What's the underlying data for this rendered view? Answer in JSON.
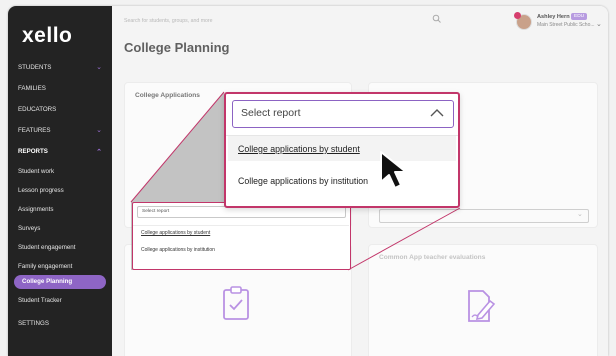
{
  "app": {
    "logo": "xello"
  },
  "sidebar": {
    "items": [
      {
        "label": "STUDENTS",
        "chevron": "chevron-down"
      },
      {
        "label": "FAMILIES"
      },
      {
        "label": "EDUCATORS"
      },
      {
        "label": "FEATURES",
        "chevron": "chevron-down"
      },
      {
        "label": "REPORTS",
        "chevron": "chevron-up"
      },
      {
        "label": "Student work"
      },
      {
        "label": "Lesson progress"
      },
      {
        "label": "Assignments"
      },
      {
        "label": "Surveys"
      },
      {
        "label": "Student engagement"
      },
      {
        "label": "Family engagement"
      },
      {
        "label": "College Planning",
        "active": true
      },
      {
        "label": "Student Tracker"
      },
      {
        "label": "SETTINGS"
      }
    ]
  },
  "header": {
    "search_placeholder": "Search for students, groups, and more",
    "user_name": "Ashley Hern",
    "user_role": "EDU",
    "user_school": "Main Street Public Scho..."
  },
  "page": {
    "title": "College Planning",
    "cards": [
      {
        "title": "College Applications",
        "select_label": "Select report"
      },
      {
        "title": "Common App teacher evaluations"
      }
    ]
  },
  "dropdown": {
    "placeholder": "Select report",
    "options": [
      "College applications by student",
      "College applications by institution"
    ]
  },
  "colors": {
    "accent_purple": "#8e65c5",
    "highlight_pink": "#c2366a",
    "sidebar_bg": "#232323"
  }
}
